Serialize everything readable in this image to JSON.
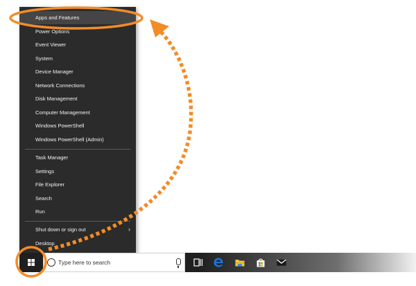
{
  "menu": {
    "items": [
      {
        "label": "Apps and Features",
        "highlighted": true
      },
      {
        "label": "Power Options"
      },
      {
        "label": "Event Viewer"
      },
      {
        "label": "System"
      },
      {
        "label": "Device Manager"
      },
      {
        "label": "Network Connections"
      },
      {
        "label": "Disk Management"
      },
      {
        "label": "Computer Management"
      },
      {
        "label": "Windows PowerShell"
      },
      {
        "label": "Windows PowerShell (Admin)"
      },
      {
        "label": "Task Manager"
      },
      {
        "label": "Settings"
      },
      {
        "label": "File Explorer"
      },
      {
        "label": "Search"
      },
      {
        "label": "Run"
      },
      {
        "label": "Shut down or sign out",
        "has_submenu": true
      },
      {
        "label": "Desktop"
      }
    ],
    "submenu_glyph": "›"
  },
  "taskbar": {
    "search_placeholder": "Type here to search",
    "icons": [
      "start-windows-icon",
      "search-icon",
      "microphone-icon",
      "task-view-icon",
      "edge-icon",
      "file-explorer-icon",
      "store-icon",
      "mail-icon"
    ]
  },
  "annotation": {
    "color": "#f28c28"
  },
  "colors": {
    "menu_bg": "#2b2b2b",
    "menu_highlight": "#454545",
    "edge_blue": "#1e73d6",
    "folder_yellow": "#f3c344"
  }
}
